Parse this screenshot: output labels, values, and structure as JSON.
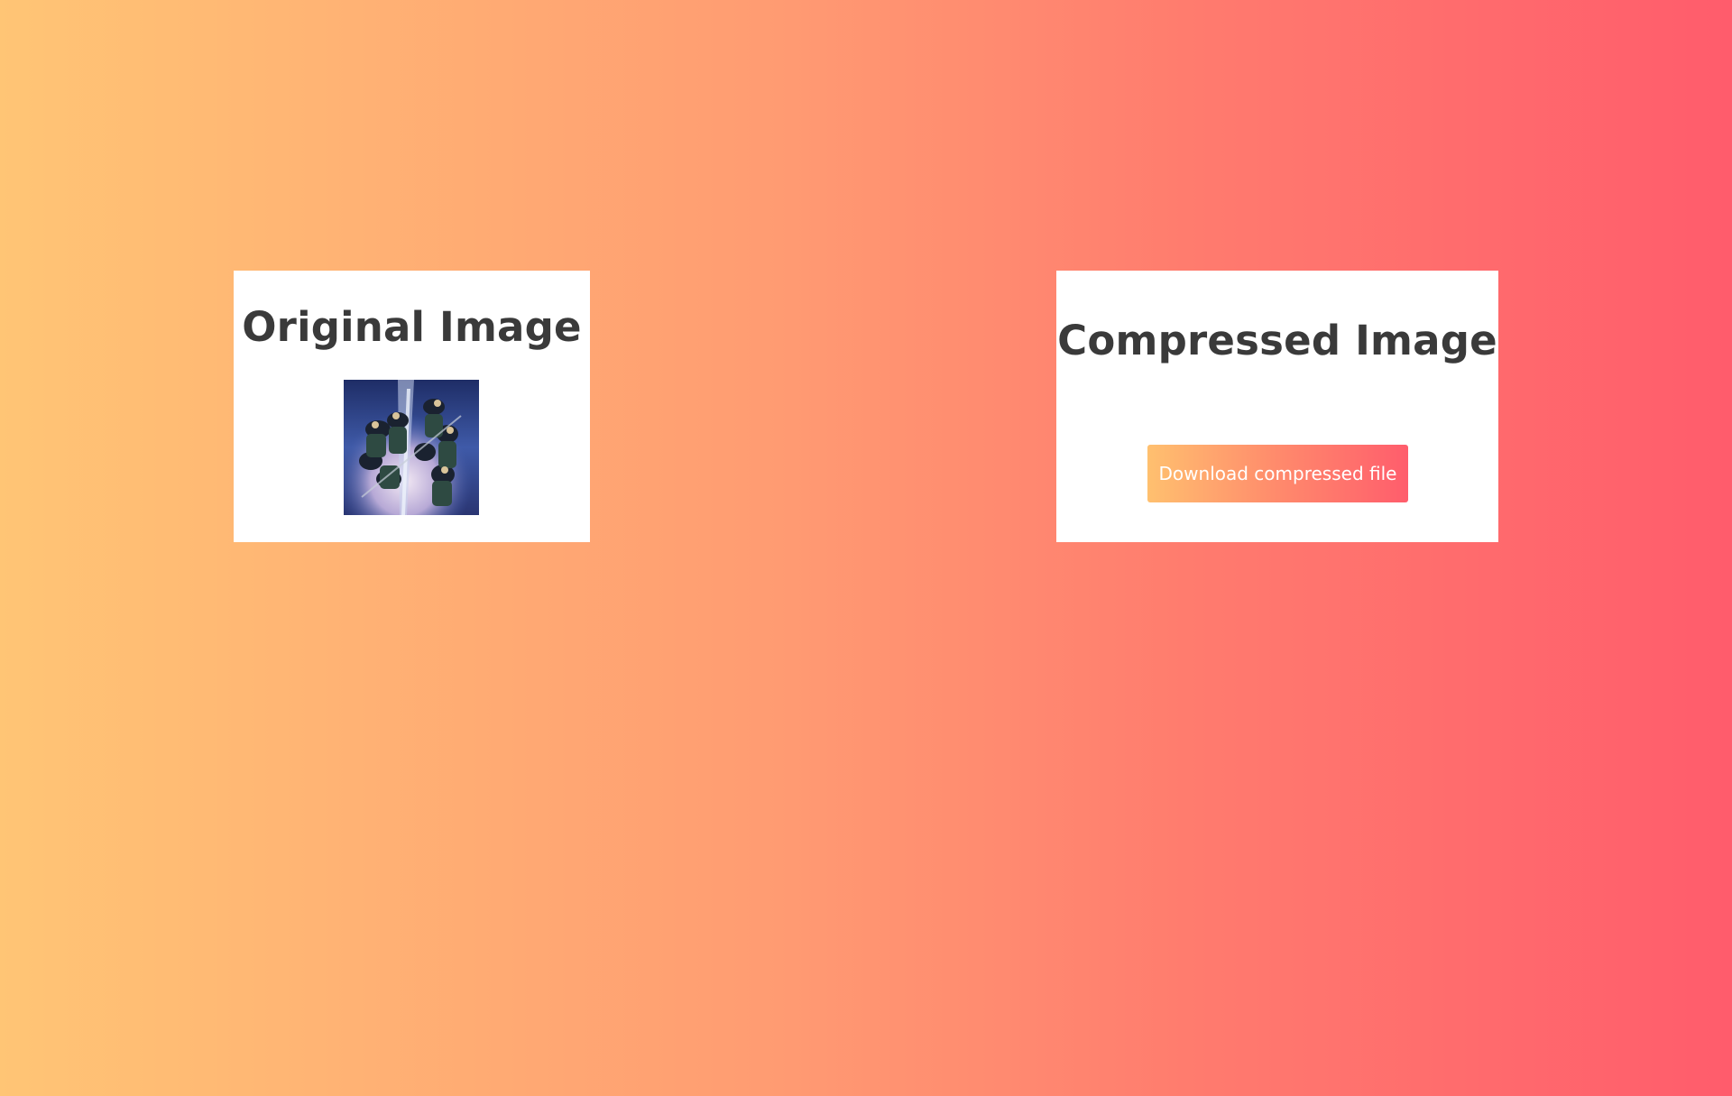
{
  "original": {
    "title": "Original Image",
    "thumbnail": "anime-group-poster-image"
  },
  "compressed": {
    "title": "Compressed Image",
    "download_label": "Download compressed file"
  },
  "colors": {
    "background_start": "#ffc575",
    "background_end": "#ff5c6c",
    "card": "#ffffff",
    "title_text": "#3a3a3a",
    "button_text": "#ffffff"
  }
}
